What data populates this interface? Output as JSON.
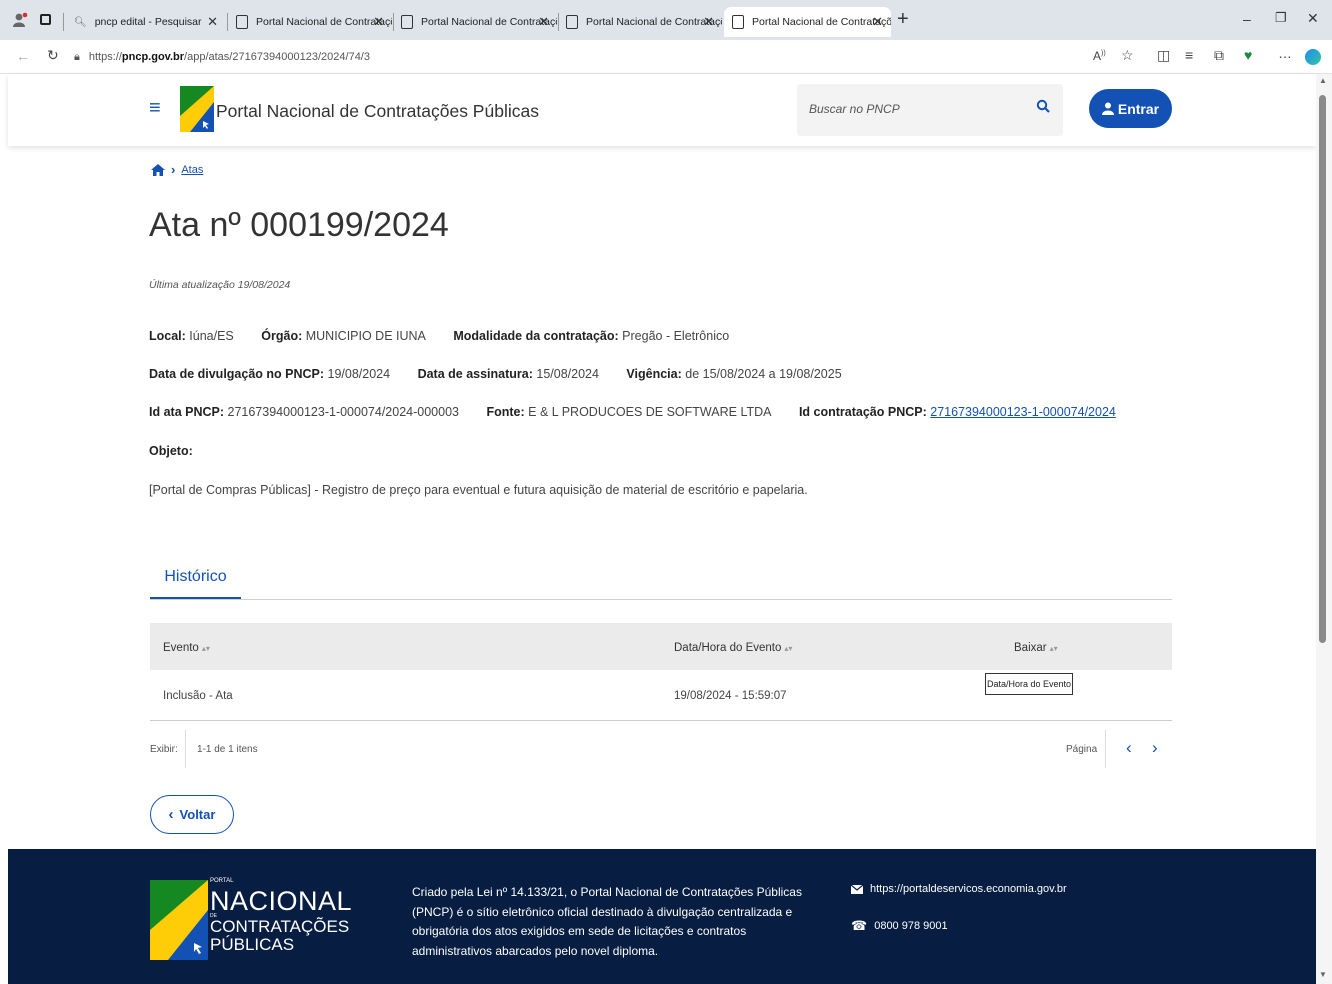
{
  "browser": {
    "tabs": [
      {
        "label": "pncp edital - Pesquisar"
      },
      {
        "label": "Portal Nacional de Contrataçõe:"
      },
      {
        "label": "Portal Nacional de Contrataçõe:"
      },
      {
        "label": "Portal Nacional de Contrataçõe:"
      },
      {
        "label": "Portal Nacional de Contrataçõe:"
      }
    ],
    "url_prefix": "https://",
    "url_domain": "pncp.gov.br",
    "url_path": "/app/atas/27167394000123/2024/74/3"
  },
  "header": {
    "title": "Portal Nacional de Contratações Públicas",
    "search_placeholder": "Buscar no PNCP",
    "login_label": "Entrar"
  },
  "breadcrumb": {
    "current": "Atas"
  },
  "page": {
    "title": "Ata nº 000199/2024",
    "last_update": "Última atualização 19/08/2024",
    "local_label": "Local:",
    "local_value": "Iúna/ES",
    "orgao_label": "Órgão:",
    "orgao_value": "MUNICIPIO DE IUNA",
    "modalidade_label": "Modalidade da contratação:",
    "modalidade_value": "Pregão - Eletrônico",
    "divulgacao_label": "Data de divulgação no PNCP:",
    "divulgacao_value": "19/08/2024",
    "assinatura_label": "Data de assinatura:",
    "assinatura_value": "15/08/2024",
    "vigencia_label": "Vigência:",
    "vigencia_value": "de 15/08/2024 a 19/08/2025",
    "id_ata_label": "Id ata PNCP:",
    "id_ata_value": "27167394000123-1-000074/2024-000003",
    "fonte_label": "Fonte:",
    "fonte_value": "E & L PRODUCOES DE SOFTWARE LTDA",
    "id_contratacao_label": "Id contratação PNCP:",
    "id_contratacao_value": "27167394000123-1-000074/2024",
    "objeto_label": "Objeto:",
    "objeto_text": "[Portal de Compras Públicas] - Registro de preço para eventual e futura aquisição de material de escritório e papelaria."
  },
  "history": {
    "tab_label": "Histórico",
    "columns": [
      "Evento",
      "Data/Hora do Evento",
      "Baixar"
    ],
    "rows": [
      {
        "evento": "Inclusão - Ata",
        "data_hora": "19/08/2024 - 15:59:07"
      }
    ],
    "tooltip": "Data/Hora do Evento",
    "exibir_label": "Exibir:",
    "items_count": "1-1 de 1 itens",
    "page_label": "Página"
  },
  "back_label": "Voltar",
  "footer": {
    "logo_portal": "PORTAL",
    "logo_nacional": "NACIONAL",
    "logo_de": "DE",
    "logo_contratacoes": "CONTRATAÇÕES",
    "logo_publicas": "PÚBLICAS",
    "text": "Criado pela Lei nº 14.133/21, o Portal Nacional de Contratações Públicas (PNCP) é o sítio eletrônico oficial destinado à divulgação centralizada e obrigatória dos atos exigidos em sede de licitações e contratos administrativos abarcados pelo novel diploma.",
    "email": "https://portaldeservicos.economia.gov.br",
    "phone": "0800 978 9001"
  },
  "colors": {
    "primary": "#1351b4",
    "footer_bg": "#071d41"
  }
}
